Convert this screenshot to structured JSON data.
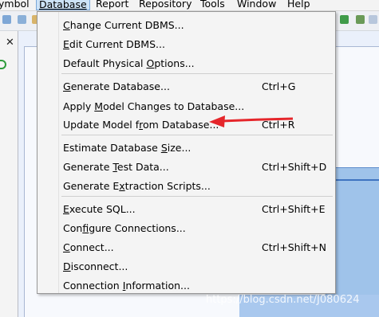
{
  "menubar": {
    "items": [
      {
        "label": "ymbol"
      },
      {
        "label": "Database"
      },
      {
        "label": "Report"
      },
      {
        "label": "Repository"
      },
      {
        "label": "Tools"
      },
      {
        "label": "Window"
      },
      {
        "label": "Help"
      }
    ]
  },
  "left_panel": {
    "close_label": "✕"
  },
  "database_menu": {
    "groups": [
      [
        {
          "pre": "",
          "ul": "C",
          "post": "hange Current DBMS...",
          "shortcut": ""
        },
        {
          "pre": "",
          "ul": "E",
          "post": "dit Current DBMS...",
          "shortcut": ""
        },
        {
          "pre": "Default Physical ",
          "ul": "O",
          "post": "ptions...",
          "shortcut": ""
        }
      ],
      [
        {
          "pre": "",
          "ul": "G",
          "post": "enerate Database...",
          "shortcut": "Ctrl+G"
        },
        {
          "pre": "Apply ",
          "ul": "M",
          "post": "odel Changes to Database...",
          "shortcut": ""
        },
        {
          "pre": "Update Model f",
          "ul": "r",
          "post": "om Database...",
          "shortcut": "Ctrl+R"
        }
      ],
      [
        {
          "pre": "Estimate Database ",
          "ul": "S",
          "post": "ize...",
          "shortcut": ""
        },
        {
          "pre": "Generate ",
          "ul": "T",
          "post": "est Data...",
          "shortcut": "Ctrl+Shift+D"
        },
        {
          "pre": "Generate E",
          "ul": "x",
          "post": "traction Scripts...",
          "shortcut": ""
        }
      ],
      [
        {
          "pre": "",
          "ul": "E",
          "post": "xecute SQL...",
          "shortcut": "Ctrl+Shift+E"
        },
        {
          "pre": "Con",
          "ul": "f",
          "post": "igure Connections...",
          "shortcut": ""
        },
        {
          "pre": "",
          "ul": "C",
          "post": "onnect...",
          "shortcut": "Ctrl+Shift+N"
        },
        {
          "pre": "",
          "ul": "D",
          "post": "isconnect...",
          "shortcut": ""
        },
        {
          "pre": "Connection ",
          "ul": "I",
          "post": "nformation...",
          "shortcut": ""
        }
      ]
    ]
  },
  "annotation": {
    "arrow_color": "#e5262b"
  },
  "watermark": "https://blog.csdn.net/J080624",
  "colors": {
    "menu_active_bg": "#cde3f7",
    "menu_active_border": "#7aa7d8",
    "workspace_blue": "#9fc3ea"
  }
}
